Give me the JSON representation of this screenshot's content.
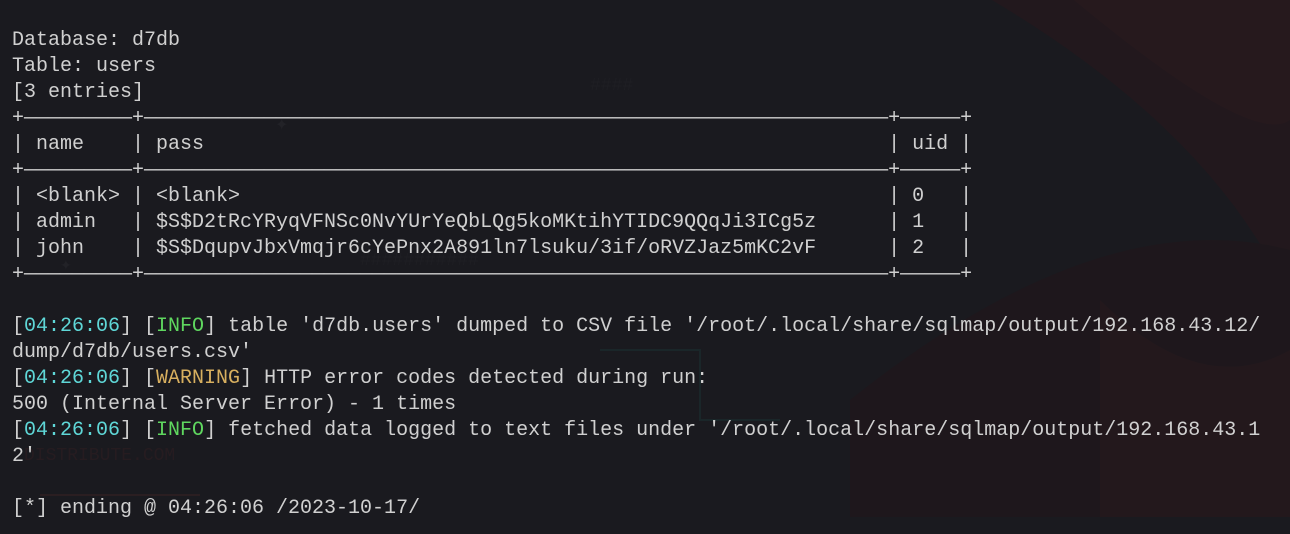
{
  "header": {
    "database_label": "Database: ",
    "database_name": "d7db",
    "table_label": "Table: ",
    "table_name": "users",
    "entries_label": "[3 entries]"
  },
  "table": {
    "top_border": "+—————————+——————————————————————————————————————————————————————————————+—————+",
    "header_row": "| name    | pass                                                         | uid |",
    "mid_border": "+—————————+——————————————————————————————————————————————————————————————+—————+",
    "rows": [
      "| <blank> | <blank>                                                      | 0   |",
      "| admin   | $S$D2tRcYRyqVFNSc0NvYUrYeQbLQg5koMKtihYTIDC9QQqJi3ICg5z      | 1   |",
      "| john    | $S$DqupvJbxVmqjr6cYePnx2A891ln7lsuku/3if/oRVZJaz5mKC2vF      | 2   |"
    ],
    "bot_border": "+—————————+——————————————————————————————————————————————————————————————+—————+"
  },
  "logs": {
    "ts1": "04:26:06",
    "lvl_info": "INFO",
    "lvl_warn": "WARNING",
    "msg1a": " table 'd7db.users' dumped to CSV file '/root/.local/share/sqlmap/output/192.168.43.12/",
    "msg1b": "dump/d7db/users.csv'",
    "ts2": "04:26:06",
    "msg2": " HTTP error codes detected during run:",
    "msg2b": "500 (Internal Server Error) - 1 times",
    "ts3": "04:26:06",
    "msg3a": " fetched data logged to text files under '/root/.local/share/sqlmap/output/192.168.43.1",
    "msg3b": "2'",
    "ending": "[*] ending @ 04:26:06 /2023-10-17/"
  }
}
